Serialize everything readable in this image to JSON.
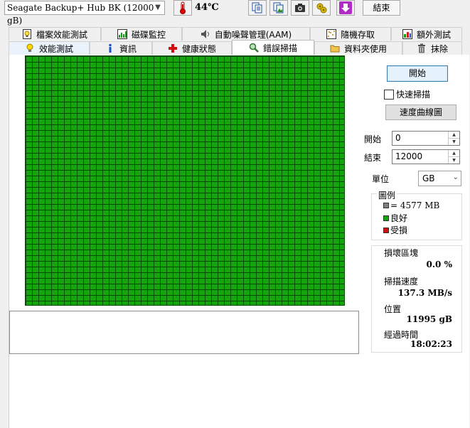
{
  "toolbar": {
    "drive": "Seagate Backup+ Hub BK (12000 gB)",
    "temperature": "44℃",
    "exit_label": "結束"
  },
  "tabs": {
    "row1": [
      {
        "label": "檔案效能測試",
        "icon": "file-benchmark-icon"
      },
      {
        "label": "磁碟監控",
        "icon": "disk-monitor-icon"
      },
      {
        "label": "自動噪聲管理(AAM)",
        "icon": "speaker-icon"
      },
      {
        "label": "隨機存取",
        "icon": "random-access-icon"
      },
      {
        "label": "額外測試",
        "icon": "extra-tests-icon"
      }
    ],
    "row2": [
      {
        "label": "效能測試",
        "icon": "lightbulb-icon"
      },
      {
        "label": "資訊",
        "icon": "info-icon"
      },
      {
        "label": "健康狀態",
        "icon": "health-cross-icon"
      },
      {
        "label": "錯誤掃描",
        "icon": "magnifier-icon"
      },
      {
        "label": "資料夾使用",
        "icon": "folder-icon"
      },
      {
        "label": "抹除",
        "icon": "trash-icon"
      }
    ],
    "active": "錯誤掃描"
  },
  "scan": {
    "start_button": "開始",
    "quick_scan_label": "快速掃描",
    "quick_scan_checked": false,
    "speed_curve_button": "速度曲線圖",
    "start_label": "開始",
    "start_value": "0",
    "end_label": "結束",
    "end_value": "12000",
    "unit_label": "單位",
    "unit_value": "GB"
  },
  "legend": {
    "title": "圖例",
    "block_size": "= 4577 MB",
    "good": "良好",
    "damaged": "受損"
  },
  "stats": {
    "damaged_blocks_label": "損壞區塊",
    "damaged_blocks_value": "0.0 %",
    "scan_speed_label": "掃描速度",
    "scan_speed_value": "137.3 MB/s",
    "position_label": "位置",
    "position_value": "11995 gB",
    "elapsed_label": "經過時間",
    "elapsed_value": "18:02:23"
  },
  "colors": {
    "block_good": "#14a50e",
    "block_damaged": "#d01010",
    "block_size_swatch": "#808080"
  }
}
